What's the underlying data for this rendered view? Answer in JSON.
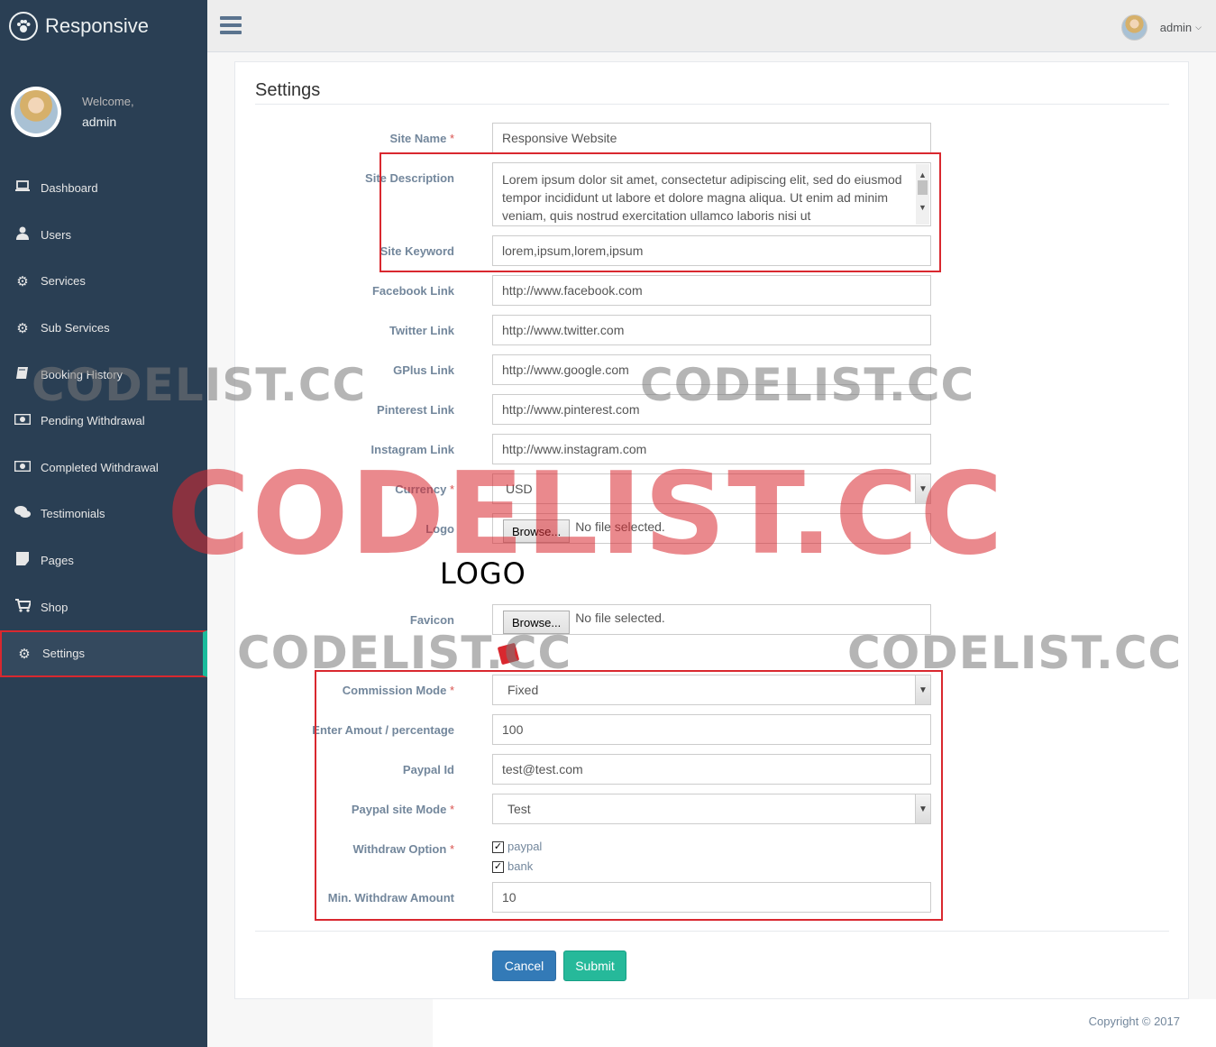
{
  "brand": {
    "name": "Responsive",
    "icon": "paw-icon"
  },
  "profile": {
    "welcome": "Welcome,",
    "name": "admin"
  },
  "nav": {
    "items": [
      {
        "label": "Dashboard",
        "icon": "laptop-icon"
      },
      {
        "label": "Users",
        "icon": "user-icon"
      },
      {
        "label": "Services",
        "icon": "gear-icon"
      },
      {
        "label": "Sub Services",
        "icon": "gear-icon"
      },
      {
        "label": "Booking History",
        "icon": "book-icon"
      },
      {
        "label": "Pending Withdrawal",
        "icon": "money-icon"
      },
      {
        "label": "Completed Withdrawal",
        "icon": "money-icon"
      },
      {
        "label": "Testimonials",
        "icon": "comments-icon"
      },
      {
        "label": "Pages",
        "icon": "file-icon"
      },
      {
        "label": "Shop",
        "icon": "cart-icon"
      },
      {
        "label": "Settings",
        "icon": "gear-icon",
        "active": true
      }
    ]
  },
  "topbar": {
    "user": "admin"
  },
  "page": {
    "title": "Settings"
  },
  "form": {
    "site_name": {
      "label": "Site Name",
      "required": "*",
      "value": "Responsive Website"
    },
    "site_description": {
      "label": "Site Description",
      "value": "Lorem ipsum dolor sit amet, consectetur adipiscing elit, sed do eiusmod tempor incididunt ut labore et dolore magna aliqua. Ut enim ad minim veniam, quis nostrud exercitation ullamco laboris nisi ut"
    },
    "site_keyword": {
      "label": "Site Keyword",
      "value": "lorem,ipsum,lorem,ipsum"
    },
    "facebook": {
      "label": "Facebook Link",
      "value": "http://www.facebook.com"
    },
    "twitter": {
      "label": "Twitter Link",
      "value": "http://www.twitter.com"
    },
    "gplus": {
      "label": "GPlus Link",
      "value": "http://www.google.com"
    },
    "pinterest": {
      "label": "Pinterest Link",
      "value": "http://www.pinterest.com"
    },
    "instagram": {
      "label": "Instagram Link",
      "value": "http://www.instagram.com"
    },
    "currency": {
      "label": "Currency",
      "required": "*",
      "value": "USD"
    },
    "logo": {
      "label": "Logo",
      "browse": "Browse...",
      "status": "No file selected.",
      "preview": "LOGO"
    },
    "favicon": {
      "label": "Favicon",
      "browse": "Browse...",
      "status": "No file selected."
    },
    "commission_mode": {
      "label": "Commission Mode",
      "required": "*",
      "value": "Fixed"
    },
    "amount": {
      "label": "Enter Amout / percentage",
      "value": "100"
    },
    "paypal_id": {
      "label": "Paypal Id",
      "value": "test@test.com"
    },
    "paypal_mode": {
      "label": "Paypal site Mode",
      "required": "*",
      "value": "Test"
    },
    "withdraw_option": {
      "label": "Withdraw Option",
      "required": "*",
      "options": [
        "paypal",
        "bank"
      ]
    },
    "min_withdraw": {
      "label": "Min. Withdraw Amount",
      "value": "10"
    }
  },
  "buttons": {
    "cancel": "Cancel",
    "submit": "Submit"
  },
  "footer": {
    "copyright": "Copyright © 2017"
  },
  "watermark": {
    "text": "CODELIST.CC"
  },
  "colors": {
    "sidebar": "#2a3f54",
    "accent": "#1abb9c",
    "highlight": "#d9282f",
    "primary": "#337ab7",
    "success": "#26b99a"
  }
}
